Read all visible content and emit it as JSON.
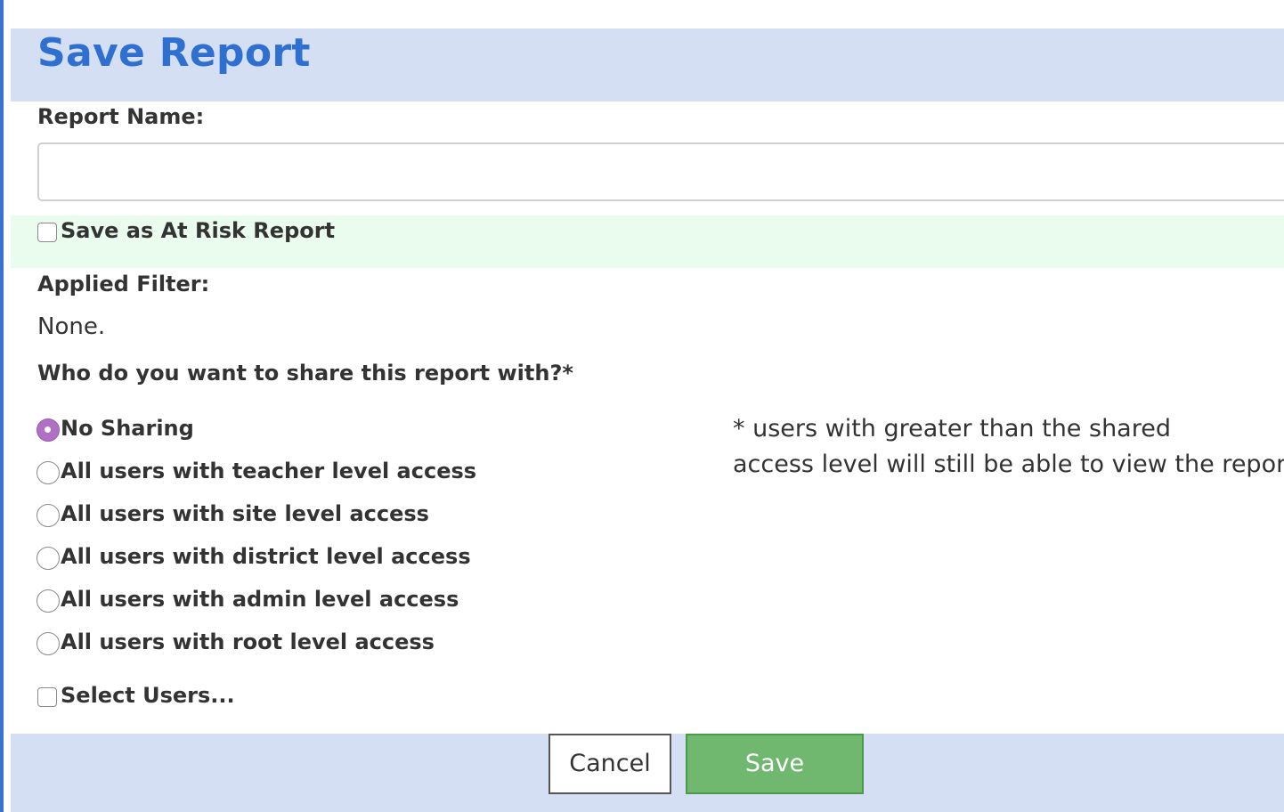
{
  "dialog": {
    "title": "Save Report"
  },
  "report_name": {
    "label": "Report Name:",
    "value": "",
    "placeholder": ""
  },
  "at_risk": {
    "label": "Save as At Risk Report",
    "checked": false
  },
  "applied_filter": {
    "label": "Applied Filter:",
    "value": "None."
  },
  "sharing": {
    "question": "Who do you want to share this report with?*",
    "options": [
      {
        "label": "No Sharing",
        "selected": true
      },
      {
        "label": "All users with teacher level access",
        "selected": false
      },
      {
        "label": "All users with site level access",
        "selected": false
      },
      {
        "label": "All users with district level access",
        "selected": false
      },
      {
        "label": "All users with admin level access",
        "selected": false
      },
      {
        "label": "All users with root level access",
        "selected": false
      }
    ],
    "note_line1": "* users with greater than the shared",
    "note_line2": "access level will still be able to view the report",
    "select_users_label": "Select Users...",
    "select_users_checked": false
  },
  "buttons": {
    "cancel_label": "Cancel",
    "save_label": "Save"
  },
  "colors": {
    "title": "#2f6fd0",
    "header_bg": "#d4dff3",
    "risk_bg": "#e9fced",
    "radio_selected": "#b070c4",
    "save_button": "#70b86f"
  }
}
